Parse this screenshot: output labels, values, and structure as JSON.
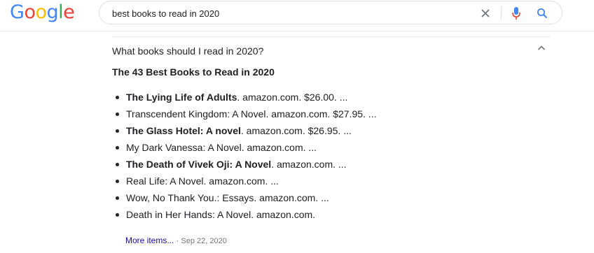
{
  "logo": {
    "letters": [
      "G",
      "o",
      "o",
      "g",
      "l",
      "e"
    ],
    "colors": [
      "#4285F4",
      "#EA4335",
      "#FBBC05",
      "#4285F4",
      "#34A853",
      "#EA4335"
    ]
  },
  "search": {
    "value": "best books to read in 2020"
  },
  "faq": {
    "question": "What books should I read in 2020?",
    "answer_title": "The 43 Best Books to Read in 2020",
    "items": [
      {
        "title": "The Lying Life of Adults",
        "rest": ". amazon.com. $26.00. ...",
        "bold": true
      },
      {
        "title": "Transcendent Kingdom: A Novel",
        "rest": ". amazon.com. $27.95. ...",
        "bold": false
      },
      {
        "title": "The Glass Hotel: A novel",
        "rest": ". amazon.com. $26.95. ...",
        "bold": true
      },
      {
        "title": "My Dark Vanessa: A Novel",
        "rest": ". amazon.com. ...",
        "bold": false
      },
      {
        "title": "The Death of Vivek Oji: A Novel",
        "rest": ". amazon.com. ...",
        "bold": true
      },
      {
        "title": "Real Life: A Novel",
        "rest": ". amazon.com. ...",
        "bold": false
      },
      {
        "title": "Wow, No Thank You.: Essays",
        "rest": ". amazon.com. ...",
        "bold": false
      },
      {
        "title": "Death in Her Hands: A Novel",
        "rest": ". amazon.com.",
        "bold": false
      }
    ],
    "more_label": "More items...",
    "separator": "·",
    "date": "Sep 22, 2020"
  },
  "colors": {
    "link": "#1a0dab",
    "mic_blue": "#4285F4",
    "mic_red": "#EA4335",
    "search_icon": "#4285F4"
  }
}
